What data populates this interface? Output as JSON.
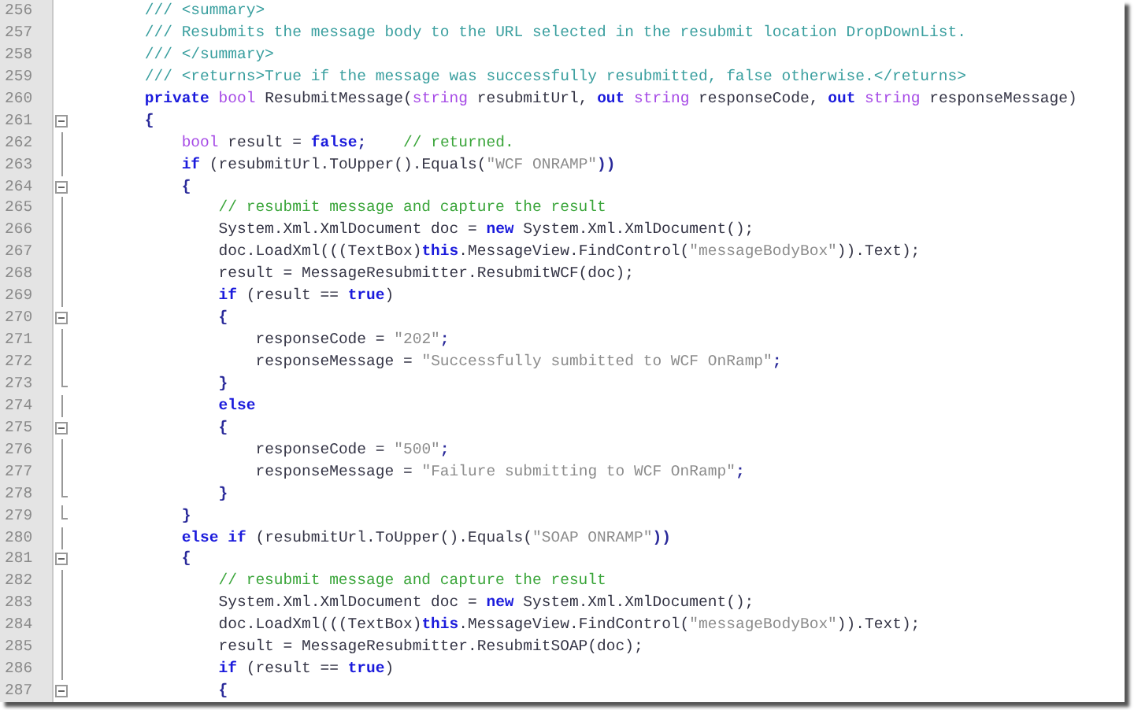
{
  "editor": {
    "lines": [
      {
        "number": "256",
        "foldable": false,
        "fold_end": false,
        "tokens": [
          {
            "kind": "doc",
            "text": "/// <summary>"
          }
        ]
      },
      {
        "number": "257",
        "foldable": false,
        "fold_end": false,
        "tokens": [
          {
            "kind": "doc",
            "text": "/// Resubmits the message body to the URL selected in the resubmit location DropDownList."
          }
        ]
      },
      {
        "number": "258",
        "foldable": false,
        "fold_end": false,
        "tokens": [
          {
            "kind": "doc",
            "text": "/// </summary>"
          }
        ]
      },
      {
        "number": "259",
        "foldable": false,
        "fold_end": false,
        "tokens": [
          {
            "kind": "doc",
            "text": "/// <returns>True if the message was successfully resubmitted, false otherwise.</returns>"
          }
        ]
      },
      {
        "number": "260",
        "foldable": false,
        "fold_end": false,
        "tokens": [
          {
            "kind": "keyword",
            "text": "private "
          },
          {
            "kind": "type",
            "text": "bool "
          },
          {
            "kind": "plain",
            "text": "ResubmitMessage("
          },
          {
            "kind": "type",
            "text": "string "
          },
          {
            "kind": "plain",
            "text": "resubmitUrl, "
          },
          {
            "kind": "keyword",
            "text": "out "
          },
          {
            "kind": "type",
            "text": "string "
          },
          {
            "kind": "plain",
            "text": "responseCode, "
          },
          {
            "kind": "keyword",
            "text": "out "
          },
          {
            "kind": "type",
            "text": "string "
          },
          {
            "kind": "plain",
            "text": "responseMessage)"
          }
        ]
      },
      {
        "number": "261",
        "foldable": true,
        "fold_end": false,
        "tokens": [
          {
            "kind": "punct",
            "text": "{"
          }
        ],
        "children": [
          {
            "number": "262",
            "foldable": false,
            "fold_end": false,
            "tokens": [
              {
                "kind": "type",
                "text": "bool "
              },
              {
                "kind": "plain",
                "text": "result = "
              },
              {
                "kind": "keyword",
                "text": "false"
              },
              {
                "kind": "punct",
                "text": ";    "
              },
              {
                "kind": "comment",
                "text": "// returned."
              }
            ]
          },
          {
            "number": "263",
            "foldable": false,
            "fold_end": false,
            "tokens": [
              {
                "kind": "keyword",
                "text": "if "
              },
              {
                "kind": "plain",
                "text": "(resubmitUrl.ToUpper().Equals("
              },
              {
                "kind": "string",
                "text": "\"WCF ONRAMP\""
              },
              {
                "kind": "punct",
                "text": "))"
              }
            ]
          },
          {
            "number": "264",
            "foldable": true,
            "fold_end": false,
            "tokens": [
              {
                "kind": "punct",
                "text": "{"
              }
            ],
            "children": [
              {
                "number": "265",
                "foldable": false,
                "fold_end": false,
                "tokens": [
                  {
                    "kind": "comment",
                    "text": "// resubmit message and capture the result"
                  }
                ]
              },
              {
                "number": "266",
                "foldable": false,
                "fold_end": false,
                "tokens": [
                  {
                    "kind": "plain",
                    "text": "System.Xml.XmlDocument doc = "
                  },
                  {
                    "kind": "keyword",
                    "text": "new "
                  },
                  {
                    "kind": "plain",
                    "text": "System.Xml.XmlDocument();"
                  }
                ]
              },
              {
                "number": "267",
                "foldable": false,
                "fold_end": false,
                "tokens": [
                  {
                    "kind": "plain",
                    "text": "doc.LoadXml(((TextBox)"
                  },
                  {
                    "kind": "keyword",
                    "text": "this"
                  },
                  {
                    "kind": "plain",
                    "text": ".MessageView.FindControl("
                  },
                  {
                    "kind": "string",
                    "text": "\"messageBodyBox\""
                  },
                  {
                    "kind": "plain",
                    "text": ")).Text);"
                  }
                ]
              },
              {
                "number": "268",
                "foldable": false,
                "fold_end": false,
                "tokens": [
                  {
                    "kind": "plain",
                    "text": "result = MessageResubmitter.ResubmitWCF(doc);"
                  }
                ]
              },
              {
                "number": "269",
                "foldable": false,
                "fold_end": false,
                "tokens": [
                  {
                    "kind": "keyword",
                    "text": "if "
                  },
                  {
                    "kind": "plain",
                    "text": "(result == "
                  },
                  {
                    "kind": "keyword",
                    "text": "true"
                  },
                  {
                    "kind": "plain",
                    "text": ")"
                  }
                ]
              },
              {
                "number": "270",
                "foldable": true,
                "fold_end": false,
                "tokens": [
                  {
                    "kind": "punct",
                    "text": "{"
                  }
                ],
                "children": [
                  {
                    "number": "271",
                    "foldable": false,
                    "fold_end": false,
                    "tokens": [
                      {
                        "kind": "plain",
                        "text": "responseCode = "
                      },
                      {
                        "kind": "string",
                        "text": "\"202\""
                      },
                      {
                        "kind": "punct",
                        "text": ";"
                      }
                    ]
                  },
                  {
                    "number": "272",
                    "foldable": false,
                    "fold_end": false,
                    "tokens": [
                      {
                        "kind": "plain",
                        "text": "responseMessage = "
                      },
                      {
                        "kind": "string",
                        "text": "\"Successfully sumbitted to WCF OnRamp\""
                      },
                      {
                        "kind": "punct",
                        "text": ";"
                      }
                    ]
                  }
                ]
              },
              {
                "number": "273",
                "foldable": false,
                "fold_end": true,
                "tokens": [
                  {
                    "kind": "punct",
                    "text": "}"
                  }
                ]
              },
              {
                "number": "274",
                "foldable": false,
                "fold_end": false,
                "tokens": [
                  {
                    "kind": "keyword",
                    "text": "else"
                  }
                ]
              },
              {
                "number": "275",
                "foldable": true,
                "fold_end": false,
                "tokens": [
                  {
                    "kind": "punct",
                    "text": "{"
                  }
                ],
                "children": [
                  {
                    "number": "276",
                    "foldable": false,
                    "fold_end": false,
                    "tokens": [
                      {
                        "kind": "plain",
                        "text": "responseCode = "
                      },
                      {
                        "kind": "string",
                        "text": "\"500\""
                      },
                      {
                        "kind": "punct",
                        "text": ";"
                      }
                    ]
                  },
                  {
                    "number": "277",
                    "foldable": false,
                    "fold_end": false,
                    "tokens": [
                      {
                        "kind": "plain",
                        "text": "responseMessage = "
                      },
                      {
                        "kind": "string",
                        "text": "\"Failure submitting to WCF OnRamp\""
                      },
                      {
                        "kind": "punct",
                        "text": ";"
                      }
                    ]
                  }
                ]
              },
              {
                "number": "278",
                "foldable": false,
                "fold_end": true,
                "tokens": [
                  {
                    "kind": "punct",
                    "text": "}"
                  }
                ]
              }
            ]
          },
          {
            "number": "279",
            "foldable": false,
            "fold_end": true,
            "tokens": [
              {
                "kind": "punct",
                "text": "}"
              }
            ]
          },
          {
            "number": "280",
            "foldable": false,
            "fold_end": false,
            "tokens": [
              {
                "kind": "keyword",
                "text": "else if "
              },
              {
                "kind": "plain",
                "text": "(resubmitUrl.ToUpper().Equals("
              },
              {
                "kind": "string",
                "text": "\"SOAP ONRAMP\""
              },
              {
                "kind": "punct",
                "text": "))"
              }
            ]
          },
          {
            "number": "281",
            "foldable": true,
            "fold_end": false,
            "tokens": [
              {
                "kind": "punct",
                "text": "{"
              }
            ],
            "children": [
              {
                "number": "282",
                "foldable": false,
                "fold_end": false,
                "tokens": [
                  {
                    "kind": "comment",
                    "text": "// resubmit message and capture the result"
                  }
                ]
              },
              {
                "number": "283",
                "foldable": false,
                "fold_end": false,
                "tokens": [
                  {
                    "kind": "plain",
                    "text": "System.Xml.XmlDocument doc = "
                  },
                  {
                    "kind": "keyword",
                    "text": "new "
                  },
                  {
                    "kind": "plain",
                    "text": "System.Xml.XmlDocument();"
                  }
                ]
              },
              {
                "number": "284",
                "foldable": false,
                "fold_end": false,
                "tokens": [
                  {
                    "kind": "plain",
                    "text": "doc.LoadXml(((TextBox)"
                  },
                  {
                    "kind": "keyword",
                    "text": "this"
                  },
                  {
                    "kind": "plain",
                    "text": ".MessageView.FindControl("
                  },
                  {
                    "kind": "string",
                    "text": "\"messageBodyBox\""
                  },
                  {
                    "kind": "plain",
                    "text": ")).Text);"
                  }
                ]
              },
              {
                "number": "285",
                "foldable": false,
                "fold_end": false,
                "tokens": [
                  {
                    "kind": "plain",
                    "text": "result = MessageResubmitter.ResubmitSOAP(doc);"
                  }
                ]
              },
              {
                "number": "286",
                "foldable": false,
                "fold_end": false,
                "tokens": [
                  {
                    "kind": "keyword",
                    "text": "if "
                  },
                  {
                    "kind": "plain",
                    "text": "(result == "
                  },
                  {
                    "kind": "keyword",
                    "text": "true"
                  },
                  {
                    "kind": "plain",
                    "text": ")"
                  }
                ]
              },
              {
                "number": "287",
                "foldable": true,
                "fold_end": false,
                "tokens": [
                  {
                    "kind": "punct",
                    "text": "{"
                  }
                ]
              }
            ]
          }
        ]
      }
    ]
  }
}
